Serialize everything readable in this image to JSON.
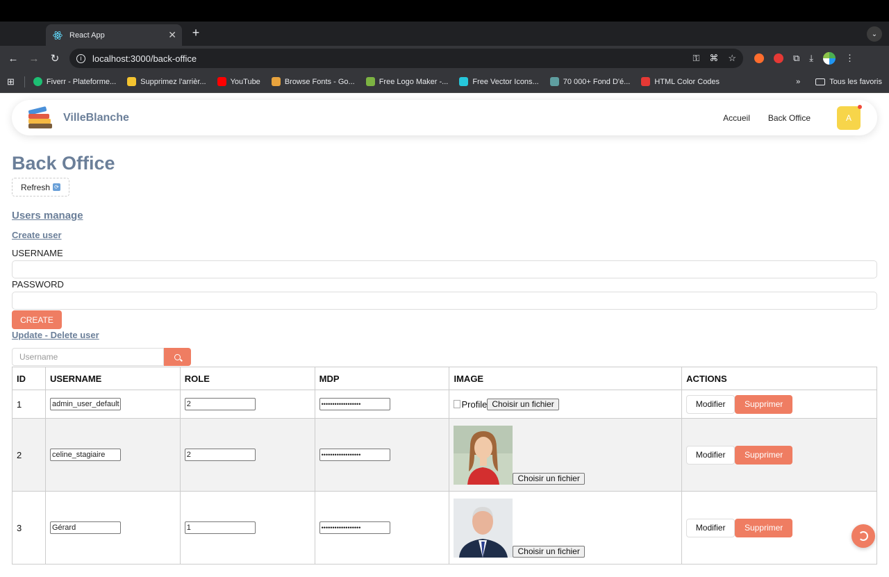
{
  "browser": {
    "tab_title": "React App",
    "new_tab": "+",
    "url": "localhost:3000/back-office",
    "bookmarks": [
      {
        "label": "Fiverr - Plateforme...",
        "color": "#1dbf73"
      },
      {
        "label": "Supprimez l'arrièr...",
        "color": "#f4c430"
      },
      {
        "label": "YouTube",
        "color": "#ff0000"
      },
      {
        "label": "Browse Fonts - Go...",
        "color": "#e8a33d"
      },
      {
        "label": "Free Logo Maker -...",
        "color": "#7cb342"
      },
      {
        "label": "Free Vector Icons...",
        "color": "#26c6da"
      },
      {
        "label": "70 000+ Fond D'é...",
        "color": "#5f9ea0"
      },
      {
        "label": "HTML Color Codes",
        "color": "#e53935"
      }
    ],
    "bookmarks_more": "»",
    "all_favorites": "Tous les favoris"
  },
  "navbar": {
    "brand": "VilleBlanche",
    "links": [
      "Accueil",
      "Back Office"
    ],
    "avatar_letter": "A"
  },
  "page": {
    "title": "Back Office",
    "refresh_label": "Refresh",
    "users_manage": "Users manage",
    "create_user": "Create user",
    "username_label": "USERNAME",
    "password_label": "PASSWORD",
    "create_button": "CREATE",
    "update_delete": "Update - Delete user",
    "search_placeholder": "Username"
  },
  "table": {
    "headers": [
      "ID",
      "USERNAME",
      "ROLE",
      "MDP",
      "IMAGE",
      "ACTIONS"
    ],
    "rows": [
      {
        "id": "1",
        "username": "admin_user_default",
        "role": "2",
        "mdp": "••••••••••••••••••",
        "image_alt": "Profile",
        "file_label": "Choisir un fichier"
      },
      {
        "id": "2",
        "username": "celine_stagiaire",
        "role": "2",
        "mdp": "••••••••••••••••••",
        "file_label": "Choisir un fichier"
      },
      {
        "id": "3",
        "username": "Gérard",
        "role": "1",
        "mdp": "••••••••••••••••••",
        "file_label": "Choisir un fichier"
      }
    ],
    "modify_label": "Modifier",
    "delete_label": "Supprimer"
  },
  "colors": {
    "accent": "#ef7d62",
    "brand": "#6b7f99",
    "avatar": "#f7d54a"
  }
}
